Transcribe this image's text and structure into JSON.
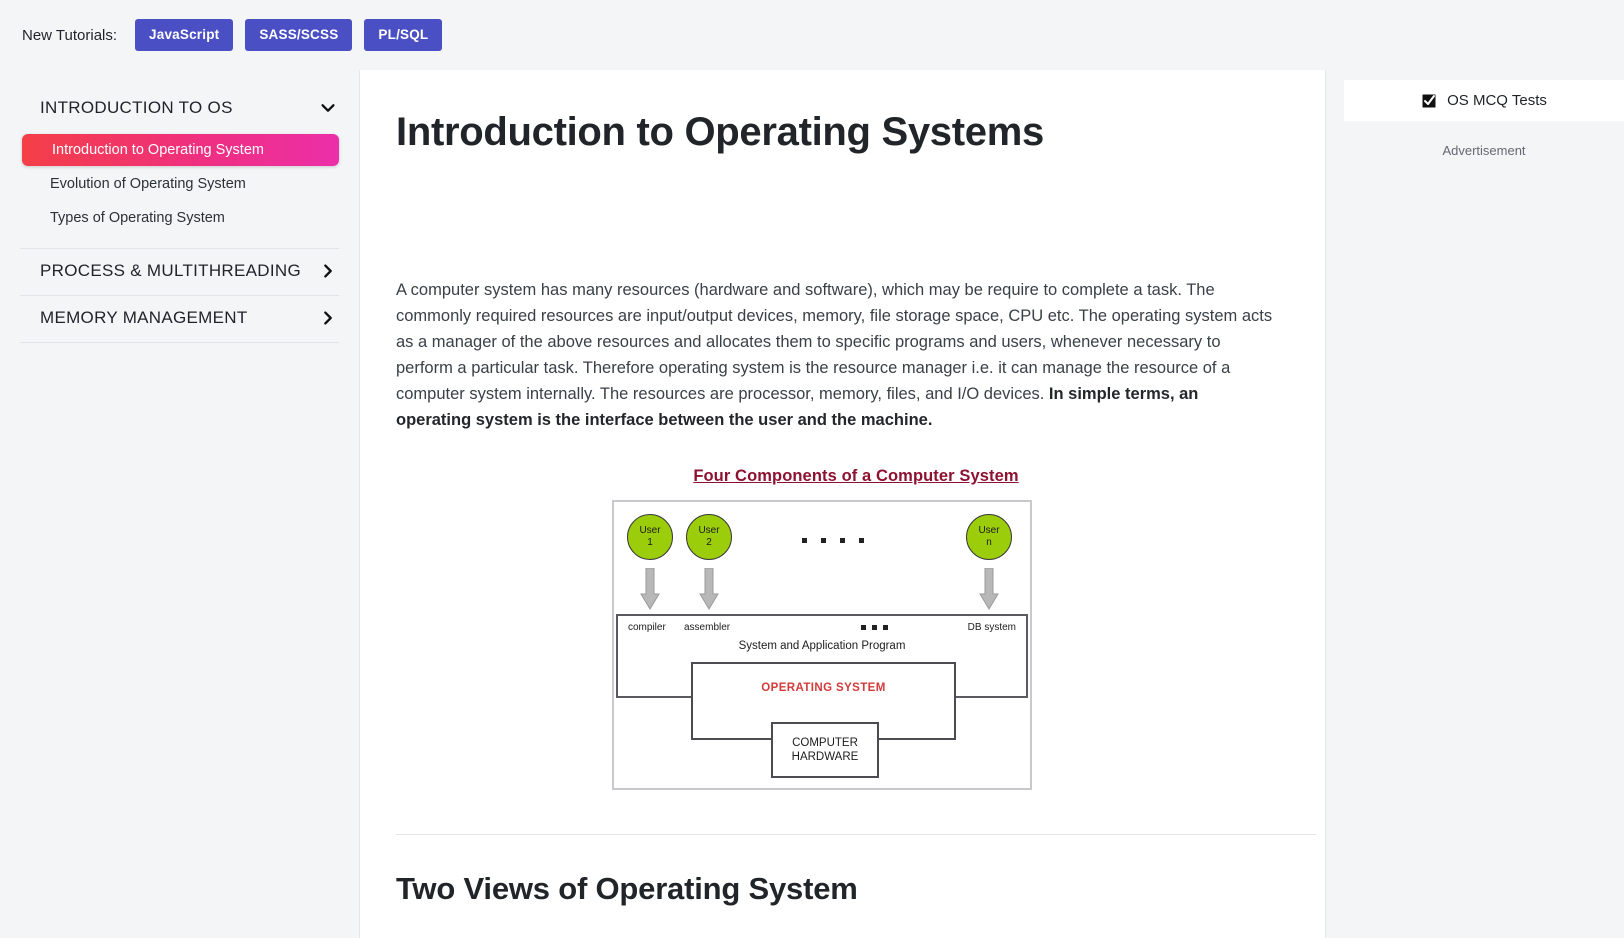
{
  "topbar": {
    "label": "New Tutorials:",
    "buttons": [
      {
        "label": "JavaScript"
      },
      {
        "label": "SASS/SCSS"
      },
      {
        "label": "PL/SQL"
      }
    ],
    "button_color": "#4b4fc4"
  },
  "sidebar": {
    "groups": [
      {
        "title": "INTRODUCTION TO OS",
        "expanded": true,
        "chevron": "chevron-down-icon",
        "items": [
          {
            "label": "Introduction to Operating System",
            "active": true
          },
          {
            "label": "Evolution of Operating System",
            "active": false
          },
          {
            "label": "Types of Operating System",
            "active": false
          }
        ]
      },
      {
        "title": "PROCESS & MULTITHREADING",
        "expanded": false,
        "chevron": "chevron-right-icon",
        "items": []
      },
      {
        "title": "MEMORY MANAGEMENT",
        "expanded": false,
        "chevron": "chevron-right-icon",
        "items": []
      }
    ],
    "active_gradient_from": "#f43f46",
    "active_gradient_to": "#ec2fa8"
  },
  "main": {
    "title": "Introduction to Operating Systems",
    "paragraph_plain": "A computer system has many resources (hardware and software), which may be require to complete a task. The commonly required resources are input/output devices, memory, file storage space, CPU etc. The operating system acts as a manager of the above resources and allocates them to specific programs and users, whenever necessary to perform a particular task. Therefore operating system is the resource manager i.e. it can manage the resource of a computer system internally. The resources are processor, memory, files, and I/O devices. ",
    "paragraph_bold": "In simple terms, an operating system is the interface between the user and the machine.",
    "section_title": "Two Views of Operating System"
  },
  "figure": {
    "title": "Four Components of a Computer System",
    "title_color": "#8d1231",
    "users": [
      {
        "line1": "User",
        "line2": "1"
      },
      {
        "line1": "User",
        "line2": "2"
      },
      {
        "line1": "User",
        "line2": "n"
      }
    ],
    "user_circle_color": "#9ccd0a",
    "ellipsis_dots": 4,
    "band_labels": {
      "left": "compiler",
      "second": "assembler",
      "right": "DB system",
      "center": "System and Application Program",
      "mid_dots": 3
    },
    "os_box_label": "OPERATING SYSTEM",
    "os_box_color": "#d33a3a",
    "hardware_box_line1": "COMPUTER",
    "hardware_box_line2": "HARDWARE"
  },
  "rail": {
    "mcq_label": "OS MCQ Tests",
    "mcq_icon": "check-square-icon",
    "ad_label": "Advertisement"
  }
}
